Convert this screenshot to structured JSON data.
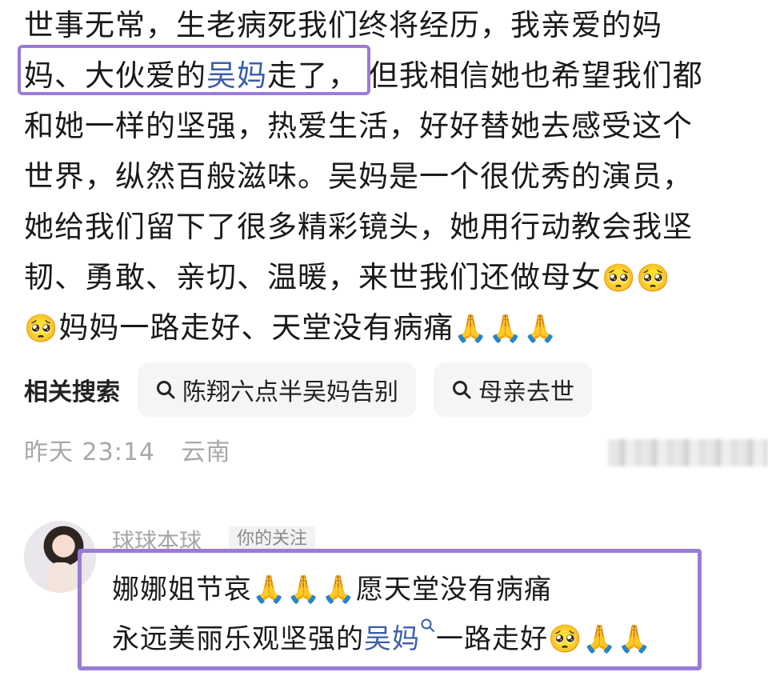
{
  "post": {
    "lines": [
      "世事无常，生老病死我们终将经历，我亲爱的妈",
      "妈、大伙爱的",
      "吴妈",
      "走了，",
      "但我相信她也希望我们都",
      "和她一样的坚强，热爱生活，好好替她去感受这个",
      "世界，纵然百般滋味。吴妈是一个很优秀的演员，",
      "她给我们留下了很多精彩镜头，她用行动教会我坚",
      "韧、勇敢、亲切、温暖，来世我们还做母女",
      "妈妈一路走好、天堂没有病痛"
    ],
    "emoji_cry": "🥺",
    "emoji_pray": "🙏"
  },
  "related": {
    "label": "相关搜索",
    "chips": [
      "陈翔六点半吴妈告别",
      "母亲去世"
    ]
  },
  "meta": {
    "time": "昨天 23:14",
    "location": "云南"
  },
  "comment": {
    "username": "球球本球",
    "tag": "你的关注",
    "line1_text": "娜娜姐节哀",
    "line1_tail": "愿天堂没有病痛",
    "line2_pre": "永远美丽乐观坚强的",
    "line2_link": "吴妈",
    "line2_post": "一路走好"
  },
  "colors": {
    "link": "#3a5fa8",
    "highlight": "#9b7bd6",
    "meta": "#a8a8a8"
  }
}
